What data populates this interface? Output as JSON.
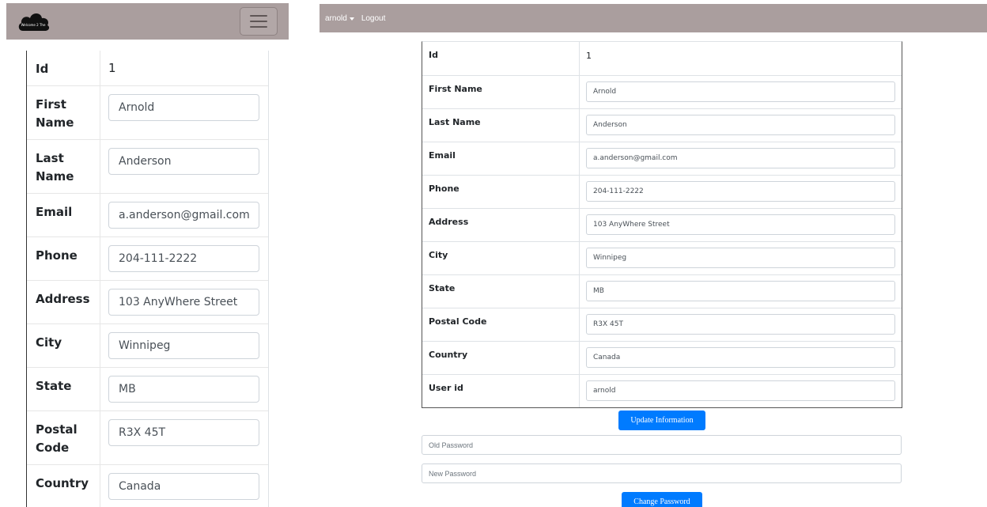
{
  "mobile": {
    "logo_text": "Welcome 2 The",
    "rows": [
      {
        "label": "Id",
        "value": "1",
        "type": "text"
      },
      {
        "label": "First Name",
        "value": "Arnold",
        "type": "input"
      },
      {
        "label": "Last Name",
        "value": "Anderson",
        "type": "input"
      },
      {
        "label": "Email",
        "value": "a.anderson@gmail.com",
        "type": "input"
      },
      {
        "label": "Phone",
        "value": "204-111-2222",
        "type": "input"
      },
      {
        "label": "Address",
        "value": "103 AnyWhere Street",
        "type": "input"
      },
      {
        "label": "City",
        "value": "Winnipeg",
        "type": "input"
      },
      {
        "label": "State",
        "value": "MB",
        "type": "input"
      },
      {
        "label": "Postal Code",
        "value": "R3X 45T",
        "type": "input"
      },
      {
        "label": "Country",
        "value": "Canada",
        "type": "input"
      }
    ]
  },
  "desktop": {
    "nav": {
      "username": "arnold",
      "logout": "Logout"
    },
    "rows": [
      {
        "label": "Id",
        "value": "1",
        "type": "text"
      },
      {
        "label": "First Name",
        "value": "Arnold",
        "type": "input"
      },
      {
        "label": "Last Name",
        "value": "Anderson",
        "type": "input"
      },
      {
        "label": "Email",
        "value": "a.anderson@gmail.com",
        "type": "input"
      },
      {
        "label": "Phone",
        "value": "204-111-2222",
        "type": "input"
      },
      {
        "label": "Address",
        "value": "103 AnyWhere Street",
        "type": "input"
      },
      {
        "label": "City",
        "value": "Winnipeg",
        "type": "input"
      },
      {
        "label": "State",
        "value": "MB",
        "type": "input"
      },
      {
        "label": "Postal Code",
        "value": "R3X 45T",
        "type": "input"
      },
      {
        "label": "Country",
        "value": "Canada",
        "type": "input"
      },
      {
        "label": "User id",
        "value": "arnold",
        "type": "input"
      }
    ],
    "update_button": "Update Information",
    "old_password_placeholder": "Old Password",
    "new_password_placeholder": "New Password",
    "change_button": "Change Password"
  },
  "colors": {
    "navbar": "#aa9e9e",
    "primary_button": "#007bff"
  },
  "icons": {
    "mobile_logo": "cloud-logo-icon",
    "mobile_menu": "hamburger-menu-icon",
    "desktop_dropdown": "caret-down-icon"
  }
}
